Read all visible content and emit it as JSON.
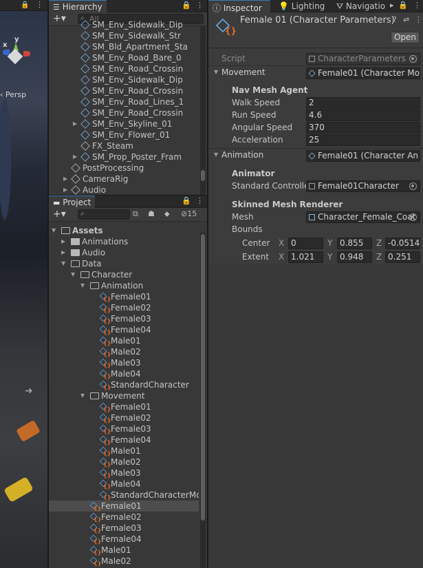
{
  "scene": {
    "persp_label": "‹ Persp",
    "axis_y": "y",
    "axis_x": "x"
  },
  "hierarchy": {
    "tab_label": "Hierarchy",
    "search_placeholder": "All",
    "items": [
      {
        "label": "SM_Env_Sidewalk_Dip",
        "indent": 2,
        "arrow": false,
        "prefab": true
      },
      {
        "label": "SM_Env_Sidewalk_Str",
        "indent": 2,
        "arrow": false,
        "prefab": true
      },
      {
        "label": "SM_Bld_Apartment_Sta",
        "indent": 2,
        "arrow": false,
        "prefab": true
      },
      {
        "label": "SM_Env_Road_Bare_0",
        "indent": 2,
        "arrow": false,
        "prefab": true
      },
      {
        "label": "SM_Env_Road_Crossin",
        "indent": 2,
        "arrow": false,
        "prefab": true
      },
      {
        "label": "SM_Env_Sidewalk_Dip",
        "indent": 2,
        "arrow": false,
        "prefab": true
      },
      {
        "label": "SM_Env_Road_Crossin",
        "indent": 2,
        "arrow": false,
        "prefab": true
      },
      {
        "label": "SM_Env_Road_Lines_1",
        "indent": 2,
        "arrow": false,
        "prefab": true
      },
      {
        "label": "SM_Env_Road_Crossin",
        "indent": 2,
        "arrow": false,
        "prefab": true
      },
      {
        "label": "SM_Env_Skyline_01",
        "indent": 2,
        "arrow": true,
        "prefab": true
      },
      {
        "label": "SM_Env_Flower_01",
        "indent": 2,
        "arrow": false,
        "prefab": true
      },
      {
        "label": "FX_Steam",
        "indent": 2,
        "arrow": false,
        "prefab": false
      },
      {
        "label": "SM_Prop_Poster_Fram",
        "indent": 2,
        "arrow": true,
        "prefab": true
      },
      {
        "label": "PostProcessing",
        "indent": 1,
        "arrow": false,
        "prefab": false
      },
      {
        "label": "CameraRig",
        "indent": 1,
        "arrow": true,
        "prefab": false
      },
      {
        "label": "Audio",
        "indent": 1,
        "arrow": true,
        "prefab": false
      }
    ]
  },
  "project": {
    "tab_label": "Project",
    "hidden_count": "15",
    "tree": [
      {
        "label": "Assets",
        "indent": 0,
        "type": "folder-open",
        "arrow": "open",
        "bold": true
      },
      {
        "label": "Animations",
        "indent": 1,
        "type": "folder",
        "arrow": "closed"
      },
      {
        "label": "Audio",
        "indent": 1,
        "type": "folder",
        "arrow": "closed"
      },
      {
        "label": "Data",
        "indent": 1,
        "type": "folder-open",
        "arrow": "open"
      },
      {
        "label": "Character",
        "indent": 2,
        "type": "folder-open",
        "arrow": "open"
      },
      {
        "label": "Animation",
        "indent": 3,
        "type": "folder-open",
        "arrow": "open"
      },
      {
        "label": "Female01",
        "indent": 4,
        "type": "asset"
      },
      {
        "label": "Female02",
        "indent": 4,
        "type": "asset"
      },
      {
        "label": "Female03",
        "indent": 4,
        "type": "asset"
      },
      {
        "label": "Female04",
        "indent": 4,
        "type": "asset"
      },
      {
        "label": "Male01",
        "indent": 4,
        "type": "asset"
      },
      {
        "label": "Male02",
        "indent": 4,
        "type": "asset"
      },
      {
        "label": "Male03",
        "indent": 4,
        "type": "asset"
      },
      {
        "label": "Male04",
        "indent": 4,
        "type": "asset"
      },
      {
        "label": "StandardCharacter",
        "indent": 4,
        "type": "asset"
      },
      {
        "label": "Movement",
        "indent": 3,
        "type": "folder-open",
        "arrow": "open"
      },
      {
        "label": "Female01",
        "indent": 4,
        "type": "asset"
      },
      {
        "label": "Female02",
        "indent": 4,
        "type": "asset"
      },
      {
        "label": "Female03",
        "indent": 4,
        "type": "asset"
      },
      {
        "label": "Female04",
        "indent": 4,
        "type": "asset"
      },
      {
        "label": "Male01",
        "indent": 4,
        "type": "asset"
      },
      {
        "label": "Male02",
        "indent": 4,
        "type": "asset"
      },
      {
        "label": "Male03",
        "indent": 4,
        "type": "asset"
      },
      {
        "label": "Male04",
        "indent": 4,
        "type": "asset"
      },
      {
        "label": "StandardCharacterMo",
        "indent": 4,
        "type": "asset"
      },
      {
        "label": "Female01",
        "indent": 3,
        "type": "asset",
        "selected": true
      },
      {
        "label": "Female02",
        "indent": 3,
        "type": "asset"
      },
      {
        "label": "Female03",
        "indent": 3,
        "type": "asset"
      },
      {
        "label": "Female04",
        "indent": 3,
        "type": "asset"
      },
      {
        "label": "Male01",
        "indent": 3,
        "type": "asset"
      },
      {
        "label": "Male02",
        "indent": 3,
        "type": "asset"
      }
    ]
  },
  "inspector": {
    "tabs": [
      "Inspector",
      "Lighting",
      "Navigatio"
    ],
    "title": "Female 01 (Character Parameters)",
    "open_label": "Open",
    "script_label": "Script",
    "script_value": "CharacterParameters",
    "movement_label": "Movement",
    "movement_value": "Female01 (Character Mo",
    "navmesh_header": "Nav Mesh Agent",
    "walk_label": "Walk Speed",
    "walk_value": "2",
    "run_label": "Run Speed",
    "run_value": "4.6",
    "angular_label": "Angular Speed",
    "angular_value": "370",
    "accel_label": "Acceleration",
    "accel_value": "25",
    "animation_label": "Animation",
    "animation_value": "Female01 (Character An",
    "animator_header": "Animator",
    "controller_label": "Standard Controlle",
    "controller_value": "Female01Character",
    "smr_header": "Skinned Mesh Renderer",
    "mesh_label": "Mesh",
    "mesh_value": "Character_Female_Coat",
    "bounds_label": "Bounds",
    "center_label": "Center",
    "center": {
      "x": "0",
      "y": "0.855",
      "z": "-0.0514"
    },
    "extent_label": "Extent",
    "extent": {
      "x": "1.021",
      "y": "0.948",
      "z": "0.251"
    },
    "axis": {
      "x": "X",
      "y": "Y",
      "z": "Z"
    }
  },
  "colors": {
    "accent": "#3a79bb",
    "prefab_blue": "#6aa8e2",
    "scriptable_orange": "#e46a2a"
  }
}
